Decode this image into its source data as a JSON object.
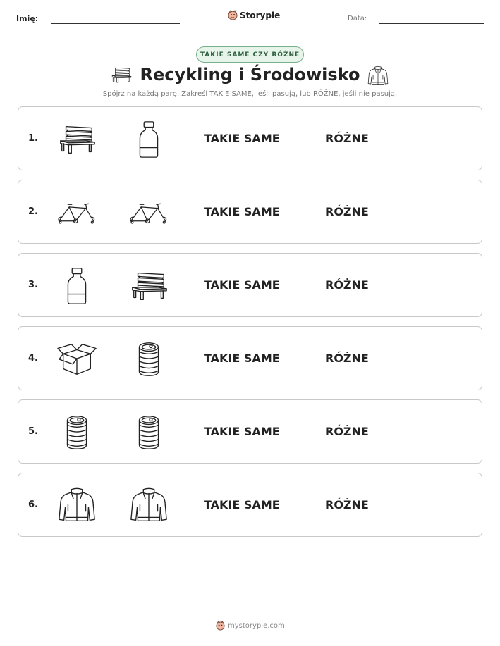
{
  "header": {
    "name_label": "Imię:",
    "date_label": "Data:",
    "brand": "Storypie"
  },
  "badge": "TAKIE SAME CZY RÓŻNE",
  "title": "Recykling i Środowisko",
  "subtitle": "Spójrz na każdą parę. Zakreśl TAKIE SAME, jeśli pasują, lub RÓŻNE, jeśli nie pasują.",
  "rows": [
    {
      "number": "1.",
      "left_icon": "bench-icon",
      "right_icon": "bottle-icon",
      "same_label": "TAKIE SAME",
      "diff_label": "RÓŻNE"
    },
    {
      "number": "2.",
      "left_icon": "bicycle-icon",
      "right_icon": "bicycle-icon",
      "same_label": "TAKIE SAME",
      "diff_label": "RÓŻNE"
    },
    {
      "number": "3.",
      "left_icon": "bottle-icon",
      "right_icon": "bench-icon",
      "same_label": "TAKIE SAME",
      "diff_label": "RÓŻNE"
    },
    {
      "number": "4.",
      "left_icon": "box-icon",
      "right_icon": "can-icon",
      "same_label": "TAKIE SAME",
      "diff_label": "RÓŻNE"
    },
    {
      "number": "5.",
      "left_icon": "can-icon",
      "right_icon": "can-icon",
      "same_label": "TAKIE SAME",
      "diff_label": "RÓŻNE"
    },
    {
      "number": "6.",
      "left_icon": "jacket-icon",
      "right_icon": "jacket-icon",
      "same_label": "TAKIE SAME",
      "diff_label": "RÓŻNE"
    }
  ],
  "footer": {
    "url": "mystorypie.com"
  },
  "colors": {
    "badge_bg": "#e6f4ea",
    "badge_border": "#79b08c",
    "badge_text": "#2f5e40",
    "row_border": "#c9c9c9"
  }
}
